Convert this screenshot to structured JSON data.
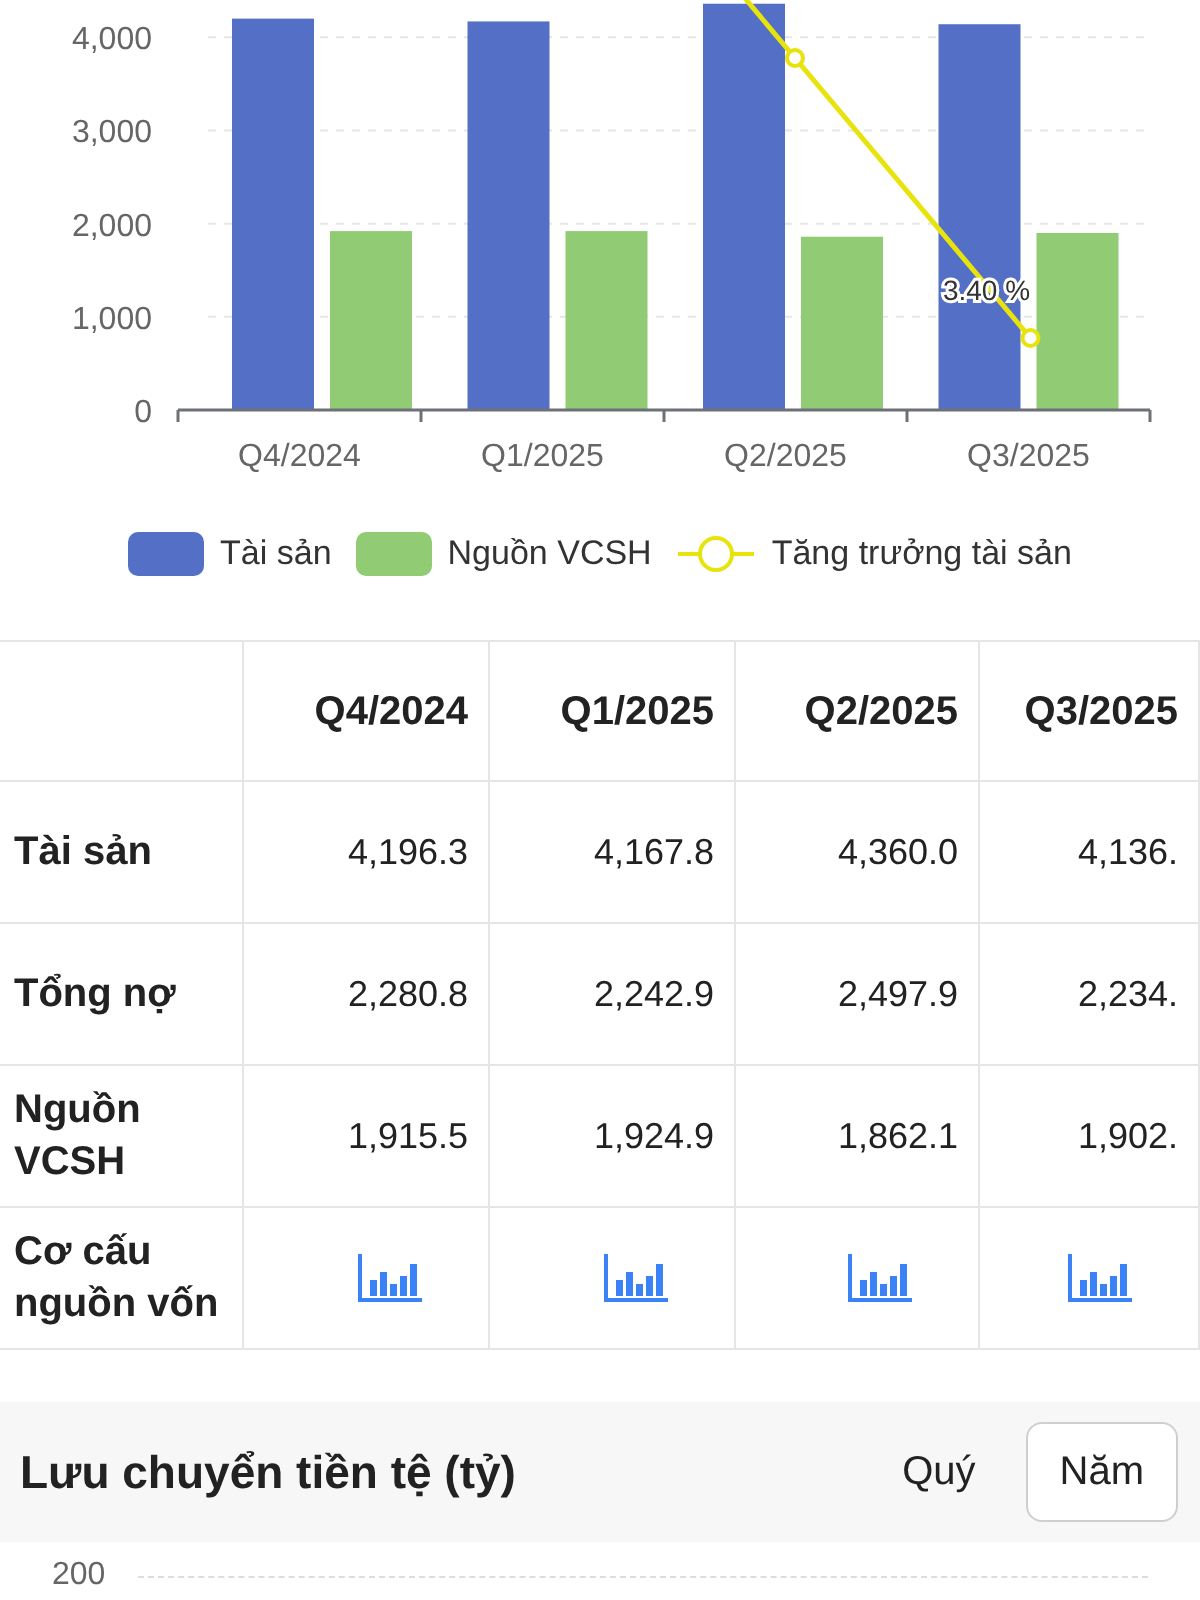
{
  "chart": {
    "chart_data": {
      "type": "bar",
      "categories": [
        "Q4/2024",
        "Q1/2025",
        "Q2/2025",
        "Q3/2025"
      ],
      "series": [
        {
          "name": "Tài sản",
          "color": "#5470c6",
          "values": [
            4200,
            4170,
            4360,
            4140
          ]
        },
        {
          "name": "Nguồn VCSH",
          "color": "#91cc75",
          "values": [
            1920,
            1920,
            1860,
            1900
          ]
        }
      ],
      "ylim": [
        0,
        4400
      ],
      "grid": true,
      "yticks": [
        {
          "value": 0,
          "label": "0"
        },
        {
          "value": 1000,
          "label": "1,000"
        },
        {
          "value": 2000,
          "label": "2,000"
        },
        {
          "value": 3000,
          "label": "3,000"
        },
        {
          "value": 4000,
          "label": "4,000"
        }
      ],
      "annotations": [
        {
          "text": "3.40 %"
        }
      ]
    },
    "line_legend": {
      "label": "Tăng trưởng tài sản",
      "color": "#e8e30c"
    }
  },
  "table": {
    "columns": [
      "Q4/2024",
      "Q1/2025",
      "Q2/2025",
      "Q3/2025"
    ],
    "rows": [
      {
        "label": "Tài sản",
        "kind": "values",
        "cells": [
          "4,196.3",
          "4,167.8",
          "4,360.0",
          "4,136."
        ]
      },
      {
        "label": "Tổng nợ",
        "kind": "values",
        "cells": [
          "2,280.8",
          "2,242.9",
          "2,497.9",
          "2,234."
        ]
      },
      {
        "label": "Nguồn VCSH",
        "kind": "values",
        "cells": [
          "1,915.5",
          "1,924.9",
          "1,862.1",
          "1,902."
        ]
      },
      {
        "label": "Cơ cấu nguồn vốn",
        "kind": "icons"
      }
    ]
  },
  "section": {
    "title": "Lưu chuyển tiền tệ (tỷ)",
    "tabs": [
      {
        "label": "Quý",
        "selected": false
      },
      {
        "label": "Năm",
        "selected": true
      }
    ],
    "axis_label": "200"
  }
}
